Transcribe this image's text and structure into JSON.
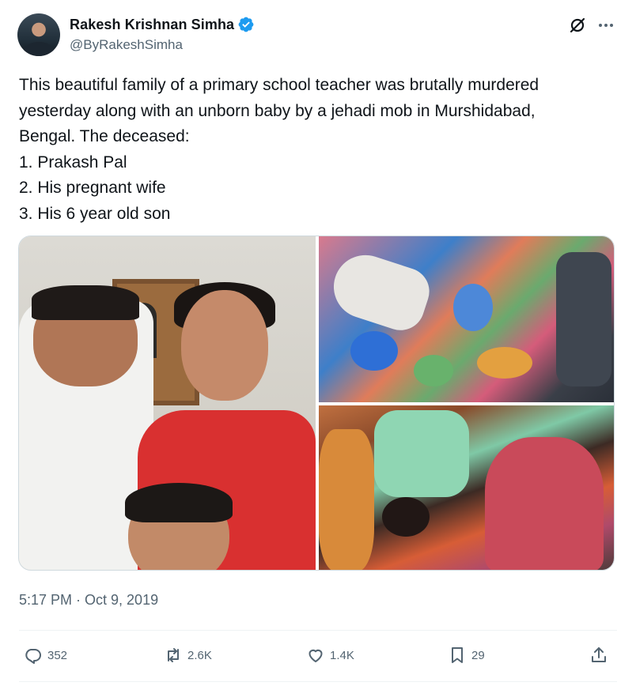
{
  "author": {
    "display_name": "Rakesh Krishnan Simha",
    "handle": "@ByRakeshSimha",
    "verified": true
  },
  "icons": {
    "verified": "verified-badge-icon",
    "grok": "grok-icon",
    "more": "more-icon",
    "reply": "reply-icon",
    "repost": "repost-icon",
    "like": "like-icon",
    "bookmark": "bookmark-icon",
    "share": "share-icon"
  },
  "tweet": {
    "lines": [
      "This beautiful family of a primary school teacher was brutally murdered",
      "yesterday along with an unborn baby by a jehadi mob in Murshidabad,",
      "Bengal. The deceased:",
      "1.  Prakash Pal",
      "2.  His pregnant wife",
      "3.  His 6 year old son"
    ],
    "timestamp": "5:17 PM · Oct 9, 2019"
  },
  "actions": {
    "reply_count": "352",
    "repost_count": "2.6K",
    "like_count": "1.4K",
    "bookmark_count": "29"
  },
  "colors": {
    "text_primary": "#0f1419",
    "text_secondary": "#536471",
    "verified_blue": "#1d9bf0",
    "divider": "#eff3f4"
  }
}
